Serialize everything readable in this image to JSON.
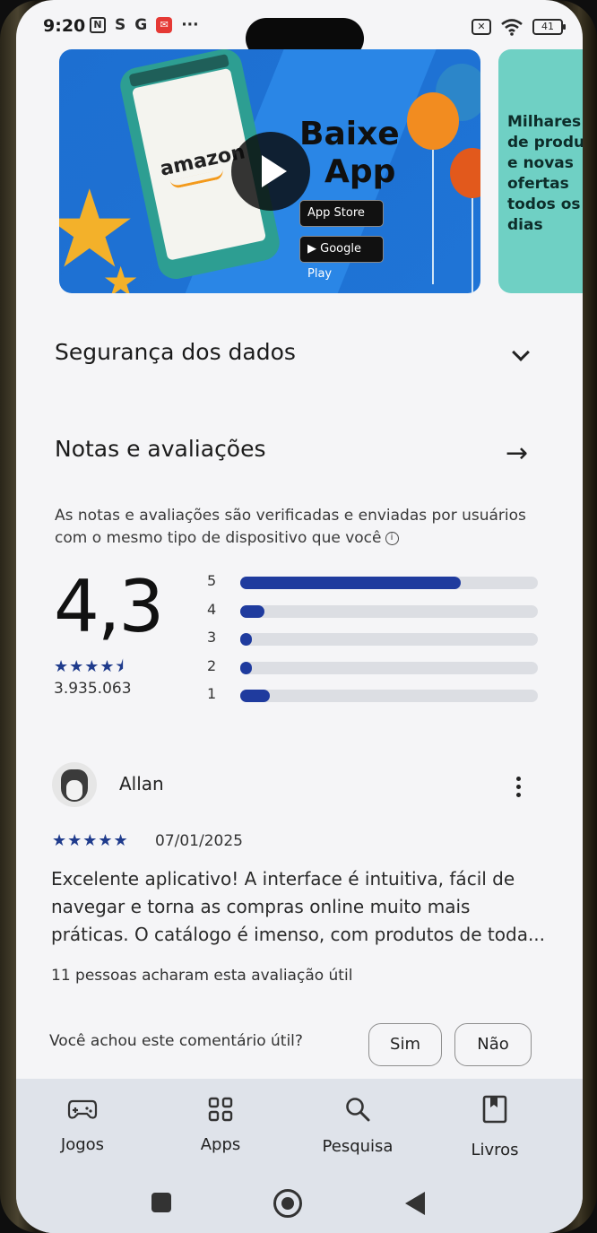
{
  "status_bar": {
    "time": "9:20",
    "left_icons": [
      "nfc-icon",
      "s-icon",
      "google-icon",
      "notification-icon",
      "more-dots-icon"
    ],
    "more_dots": "···",
    "battery": "41"
  },
  "banner": {
    "brand": "amazon",
    "title_line1": "Baixe",
    "title_line2": "App",
    "badge_apple": "App Store",
    "badge_google": "Google Play"
  },
  "banner2": {
    "text": "Milhares\nde produ\ne novas\nofertas\ntodos os\ndias"
  },
  "data_safety": {
    "title": "Segurança dos dados"
  },
  "ratings": {
    "title": "Notas e avaliações",
    "description": "As notas e avaliações são verificadas e enviadas por usuários com o mesmo tipo de dispositivo que você",
    "average": "4,3",
    "stars_display": "★★★★⯨",
    "count": "3.935.063",
    "bars": [
      {
        "label": "5",
        "fraction": 0.74
      },
      {
        "label": "4",
        "fraction": 0.08
      },
      {
        "label": "3",
        "fraction": 0.04
      },
      {
        "label": "2",
        "fraction": 0.04
      },
      {
        "label": "1",
        "fraction": 0.1
      }
    ]
  },
  "review": {
    "author": "Allan",
    "stars_display": "★★★★★",
    "date": "07/01/2025",
    "text": "Excelente aplicativo! A interface é intuitiva, fácil de navegar e torna as compras online muito mais práticas. O catálogo é imenso, com produtos de toda...",
    "helpful_count": "11 pessoas acharam esta avaliação útil",
    "helpful_question": "Você achou este comentário útil?",
    "yes_label": "Sim",
    "no_label": "Não"
  },
  "bottom_nav": {
    "items": [
      {
        "label": "Jogos",
        "icon": "gamepad-icon"
      },
      {
        "label": "Apps",
        "icon": "apps-grid-icon"
      },
      {
        "label": "Pesquisa",
        "icon": "search-icon"
      },
      {
        "label": "Livros",
        "icon": "book-icon"
      }
    ]
  },
  "colors": {
    "accent_blue": "#1f3b9e",
    "track_gray": "#dcdee3",
    "banner_blue": "#1d6fd1",
    "banner_teal": "#6fd0c4"
  }
}
